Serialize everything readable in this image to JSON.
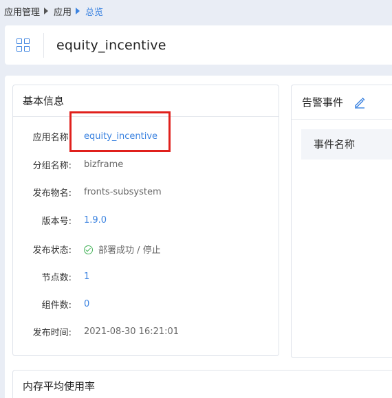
{
  "breadcrumb": {
    "items": [
      "应用管理",
      "应用",
      "总览"
    ]
  },
  "header": {
    "title": "equity_incentive"
  },
  "basic_info": {
    "title": "基本信息",
    "rows": [
      {
        "label": "应用名称:",
        "value": "equity_incentive"
      },
      {
        "label": "分组名称:",
        "value": "bizframe"
      },
      {
        "label": "发布物名:",
        "value": "fronts-subsystem"
      },
      {
        "label": "版本号:",
        "value": "1.9.0"
      },
      {
        "label": "发布状态:",
        "value": "部署成功 / 停止"
      },
      {
        "label": "节点数:",
        "value": "1"
      },
      {
        "label": "组件数:",
        "value": "0"
      },
      {
        "label": "发布时间:",
        "value": "2021-08-30 16:21:01"
      }
    ]
  },
  "alert_events": {
    "title": "告警事件",
    "column_header": "事件名称"
  },
  "memory": {
    "title": "内存平均使用率"
  },
  "colors": {
    "accent": "#3a82e0",
    "success": "#46b35a",
    "highlight": "#e0201c"
  }
}
